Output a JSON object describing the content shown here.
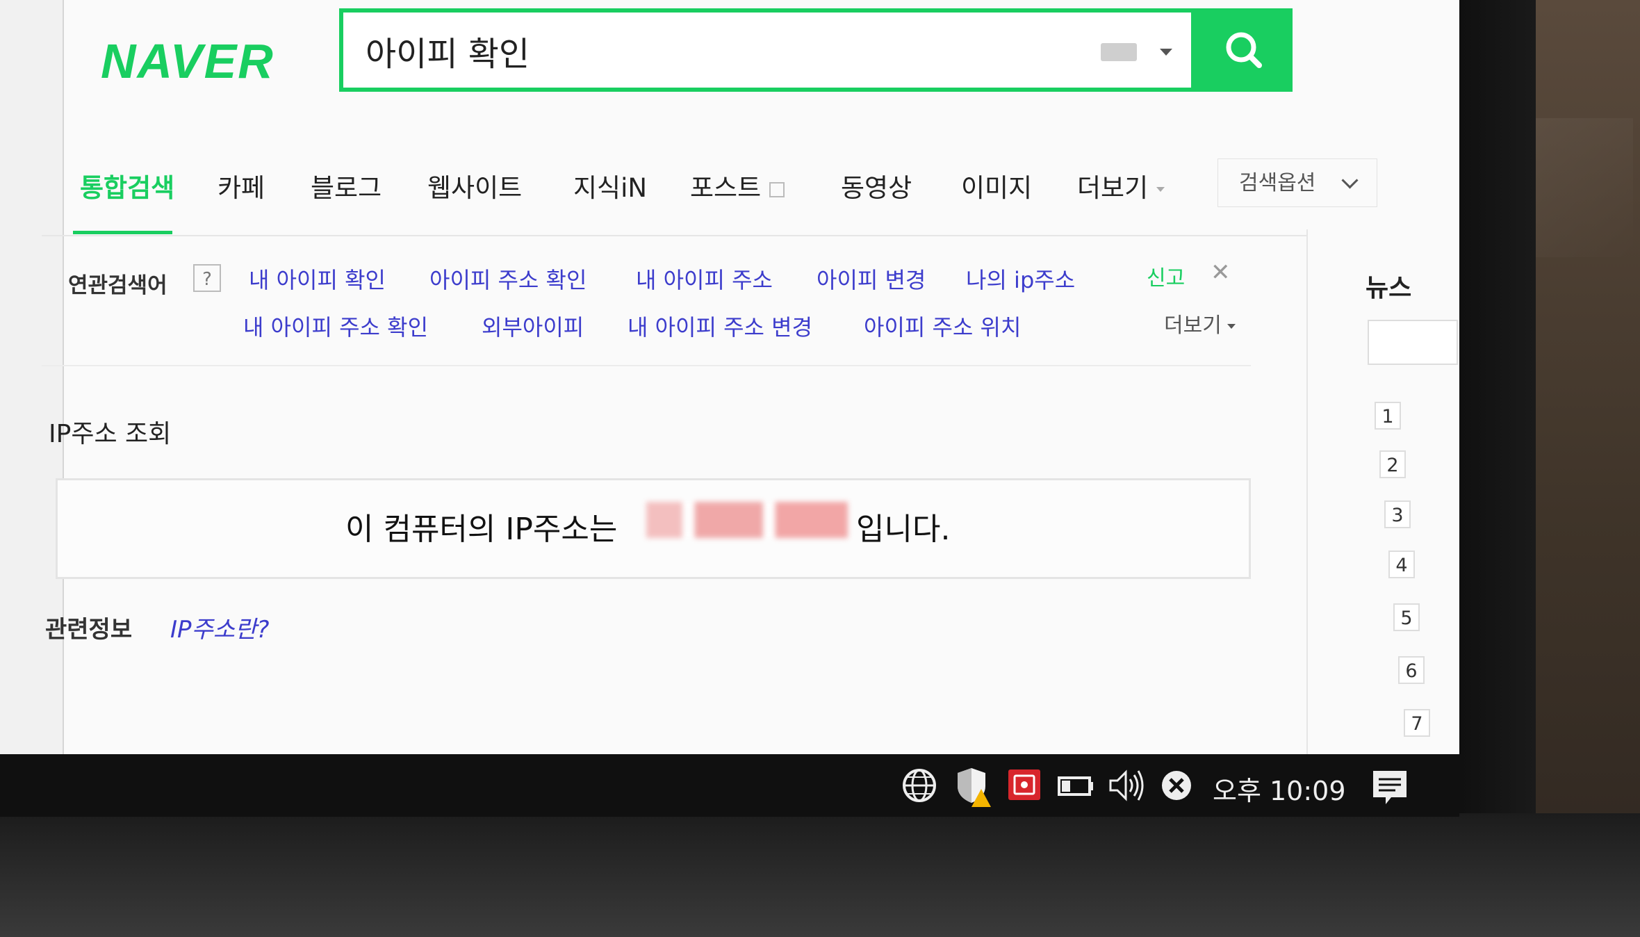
{
  "brand": {
    "logo_text": "NAVER",
    "accent": "#19ce60",
    "link": "#3c3ccc"
  },
  "search": {
    "query": "아이피 확인"
  },
  "tabs": [
    {
      "label": "통합검색",
      "active": true
    },
    {
      "label": "카페"
    },
    {
      "label": "블로그"
    },
    {
      "label": "웹사이트"
    },
    {
      "label": "지식iN"
    },
    {
      "label": "포스트"
    },
    {
      "label": "동영상"
    },
    {
      "label": "이미지"
    },
    {
      "label": "더보기"
    }
  ],
  "search_options": "검색옵션",
  "related": {
    "label": "연관검색어",
    "help": "?",
    "row1": [
      "내 아이피 확인",
      "아이피 주소 확인",
      "내 아이피 주소",
      "아이피 변경",
      "나의 ip주소"
    ],
    "row2": [
      "내 아이피 주소 확인",
      "외부아이피",
      "내 아이피 주소 변경",
      "아이피 주소 위치"
    ],
    "report": "신고",
    "close": "✕",
    "more": "더보기"
  },
  "ip_lookup": {
    "heading": "IP주소 조회",
    "prefix": "이 컴퓨터의 IP주소는",
    "suffix": "입니다."
  },
  "related_info": {
    "label": "관련정보",
    "link": "IP주소란?"
  },
  "right": {
    "news_title": "뉴스",
    "ranks": [
      "1",
      "2",
      "3",
      "4",
      "5",
      "6",
      "7"
    ]
  },
  "taskbar": {
    "clock": "오후 10:09"
  }
}
